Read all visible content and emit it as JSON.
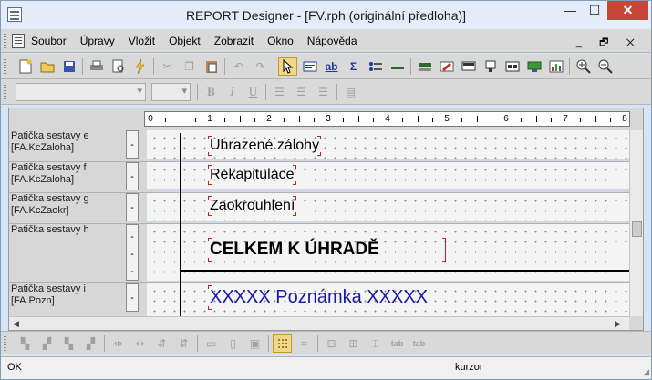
{
  "window": {
    "title": "REPORT Designer - [FV.rph (originální předloha)]",
    "min_glyph": "—",
    "max_glyph": "☐",
    "close_glyph": "✕"
  },
  "menu": {
    "items": [
      "Soubor",
      "Úpravy",
      "Vložit",
      "Objekt",
      "Zobrazit",
      "Okno",
      "Nápověda"
    ],
    "mdi_controls": "_ 🗗 ✕"
  },
  "ruler": {
    "numbers": [
      "0",
      "1",
      "2",
      "3",
      "4",
      "5",
      "6",
      "7",
      "8"
    ]
  },
  "sections": [
    {
      "label_line1": "Patička sestavy e",
      "label_line2": "[FA.KcZaloha]",
      "marker": "-",
      "field_text": "Uhrazené zálohy"
    },
    {
      "label_line1": "Patička sestavy f",
      "label_line2": "[FA.KcZaloha]",
      "marker": "-",
      "field_text": "Rekapitulace"
    },
    {
      "label_line1": "Patička sestavy g",
      "label_line2": "[FA.KcZaokr]",
      "marker": "-",
      "field_text": "Zaokrouhlení"
    },
    {
      "label_line1": "Patička sestavy h",
      "label_line2": "",
      "marker": "-\n-\n-",
      "field_text": "CELKEM K ÚHRADĚ"
    },
    {
      "label_line1": "Patička sestavy i",
      "label_line2": "[FA.Pozn]",
      "marker": "-",
      "field_text": "XXXXX Poznámka XXXXX"
    }
  ],
  "format_bar": {
    "bold": "B",
    "italic": "I",
    "underline": "U"
  },
  "statusbar": {
    "main": "OK",
    "panel": "kurzor"
  },
  "colors": {
    "note_text": "#1a1aa0",
    "handle": "#c02020",
    "close_button": "#c7463a"
  }
}
